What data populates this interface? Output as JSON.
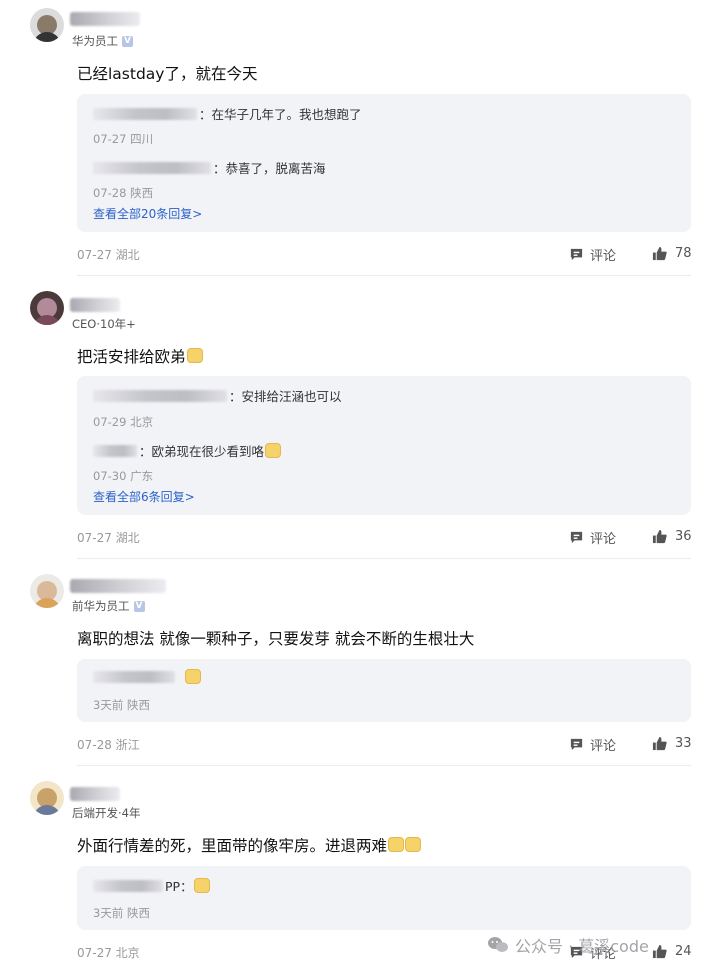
{
  "posts": [
    {
      "role": "华为员工",
      "verified": true,
      "content": "已经lastday了，就在今天",
      "emoji_count": 0,
      "replies": [
        {
          "text": "在华子几年了。我也想跑了",
          "location": "07-27 四川"
        },
        {
          "text": "恭喜了，脱离苦海",
          "location": "07-28 陕西"
        }
      ],
      "view_all": "查看全部20条回复>",
      "meta": "07-27 湖北",
      "comment_label": "评论",
      "likes": "78"
    },
    {
      "role": "CEO·10年+",
      "verified": false,
      "content": "把活安排给欧弟",
      "emoji_count": 1,
      "replies": [
        {
          "text": "安排给汪涵也可以",
          "location": "07-29 北京"
        },
        {
          "text": "欧弟现在很少看到咯",
          "location": "07-30 广东"
        }
      ],
      "view_all": "查看全部6条回复>",
      "meta": "07-27 湖北",
      "comment_label": "评论",
      "likes": "36"
    },
    {
      "role": "前华为员工",
      "verified": true,
      "content": "离职的想法 就像一颗种子，只要发芽 就会不断的生根壮大",
      "emoji_count": 0,
      "replies": [
        {
          "text": "",
          "location": "3天前 陕西"
        }
      ],
      "view_all": "",
      "meta": "07-28 浙江",
      "comment_label": "评论",
      "likes": "33"
    },
    {
      "role": "后端开发·4年",
      "verified": false,
      "content": "外面行情差的死，里面带的像牢房。进退两难",
      "emoji_count": 2,
      "replies": [
        {
          "text": "PP：",
          "location": "3天前 陕西"
        }
      ],
      "view_all": "",
      "meta": "07-27 北京",
      "comment_label": "评论",
      "likes": "24"
    }
  ],
  "watermark": {
    "text": "公众号 · 葛溪code"
  }
}
